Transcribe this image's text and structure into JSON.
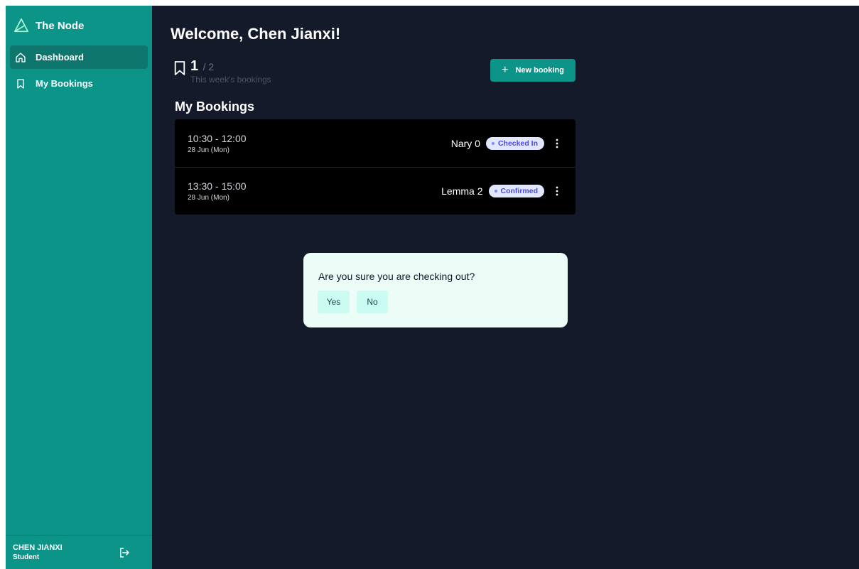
{
  "sidebar": {
    "brand": "The Node",
    "items": [
      {
        "label": "Dashboard",
        "icon": "home-icon",
        "active": true
      },
      {
        "label": "My Bookings",
        "icon": "bookmark-icon",
        "active": false
      }
    ],
    "user": {
      "name": "CHEN JIANXI",
      "role": "Student"
    }
  },
  "main": {
    "welcome": "Welcome, Chen Jianxi!",
    "stats": {
      "count": "1",
      "total": "/ 2",
      "label": "This week's bookings"
    },
    "new_booking_label": "New booking",
    "section_title": "My Bookings",
    "bookings": [
      {
        "time": "10:30 - 12:00",
        "date": "28 Jun (Mon)",
        "room": "Nary 0",
        "status": "Checked In"
      },
      {
        "time": "13:30 - 15:00",
        "date": "28 Jun (Mon)",
        "room": "Lemma 2",
        "status": "Confirmed"
      }
    ]
  },
  "dialog": {
    "message": "Are you sure you are checking out?",
    "yes_label": "Yes",
    "no_label": "No"
  },
  "colors": {
    "sidebar_bg": "#0d9488",
    "sidebar_active": "#0f766e",
    "main_bg": "#141a29",
    "badge_bg": "#e0e7ff",
    "badge_text": "#4f46e5",
    "dialog_bg": "#ecfdf8",
    "dialog_button_bg": "#ccfbf1"
  }
}
